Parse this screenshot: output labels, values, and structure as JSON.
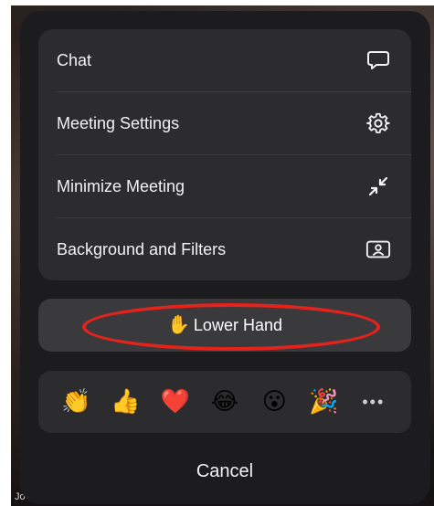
{
  "menu": {
    "items": [
      {
        "label": "Chat",
        "icon": "chat-bubble-icon"
      },
      {
        "label": "Meeting Settings",
        "icon": "gear-icon"
      },
      {
        "label": "Minimize Meeting",
        "icon": "minimize-arrows-icon"
      },
      {
        "label": "Background and Filters",
        "icon": "portrait-frame-icon"
      }
    ]
  },
  "lower_hand": {
    "label": "Lower Hand",
    "icon": "raised-hand-icon",
    "highlight_color": "#e5221c"
  },
  "reactions": {
    "items": [
      {
        "emoji": "👏",
        "name": "clap"
      },
      {
        "emoji": "👍",
        "name": "thumbs-up"
      },
      {
        "emoji": "❤️",
        "name": "heart"
      },
      {
        "emoji": "😂",
        "name": "tears-of-joy"
      },
      {
        "emoji": "😮",
        "name": "open-mouth"
      },
      {
        "emoji": "🎉",
        "name": "party-popper"
      }
    ],
    "more_label": "•••"
  },
  "cancel_label": "Cancel",
  "participant_name_fragment": "Jo"
}
